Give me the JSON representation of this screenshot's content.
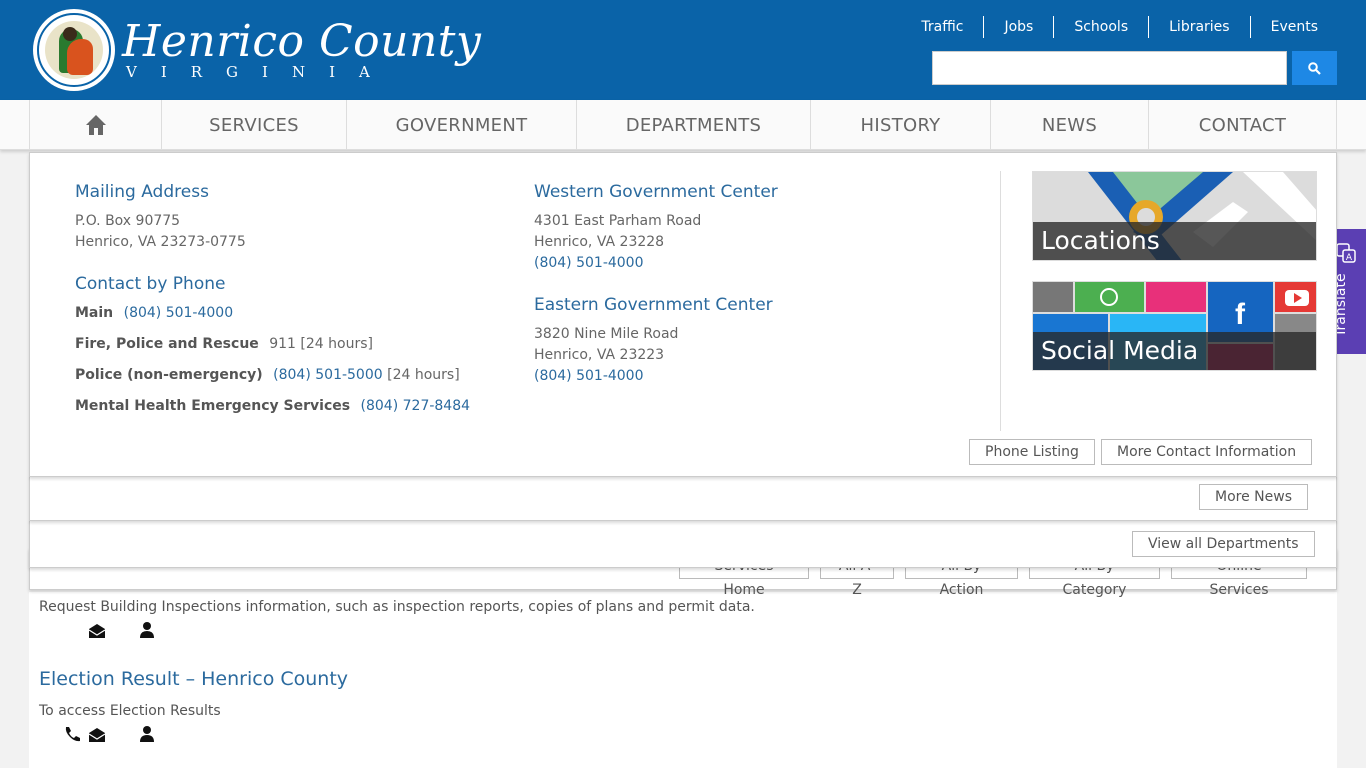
{
  "header": {
    "logo_title": "Henrico County",
    "logo_subtitle": "VIRGINIA",
    "quick_links": [
      "Traffic",
      "Jobs",
      "Schools",
      "Libraries",
      "Events"
    ],
    "search_placeholder": ""
  },
  "nav": {
    "items": [
      "SERVICES",
      "GOVERNMENT",
      "DEPARTMENTS",
      "HISTORY",
      "NEWS",
      "CONTACT"
    ]
  },
  "contact": {
    "mailing_heading": "Mailing Address",
    "mailing_line1": "P.O. Box 90775",
    "mailing_line2": "Henrico, VA 23273-0775",
    "phone_heading": "Contact by Phone",
    "phones": [
      {
        "label": "Main",
        "number": "(804) 501-4000",
        "note": ""
      },
      {
        "label": "Fire, Police and Rescue",
        "number": "911",
        "note": "[24 hours]"
      },
      {
        "label": "Police (non-emergency)",
        "number": "(804) 501-5000",
        "note": "[24 hours]"
      },
      {
        "label": "Mental Health Emergency Services",
        "number": "(804) 727-8484",
        "note": ""
      }
    ],
    "western_heading": "Western Government Center",
    "western_line1": "4301 East Parham Road",
    "western_line2": "Henrico, VA 23228",
    "western_phone": "(804) 501-4000",
    "eastern_heading": "Eastern Government Center",
    "eastern_line1": "3820 Nine Mile Road",
    "eastern_line2": "Henrico, VA 23223",
    "eastern_phone": "(804) 501-4000",
    "tile_locations": "Locations",
    "tile_social": "Social Media",
    "btn_phone_listing": "Phone Listing",
    "btn_more_contact": "More Contact Information"
  },
  "news": {
    "btn_more_news": "More News"
  },
  "departments": {
    "btn_view_all": "View all Departments"
  },
  "services_tabs": [
    "Services Home",
    "All A-Z",
    "All By Action",
    "All By Category",
    "Online Services"
  ],
  "content": {
    "item1_desc": "Request Building Inspections information, such as inspection reports, copies of plans and permit data.",
    "item2_title": "Election Result – Henrico County",
    "item2_desc": "To access Election Results"
  },
  "translate_label": "Translate",
  "colors": {
    "header_blue": "#0a63a8",
    "link_blue": "#2b6a9e",
    "search_blue": "#1e88e5",
    "translate_purple": "#5b3fb3"
  }
}
